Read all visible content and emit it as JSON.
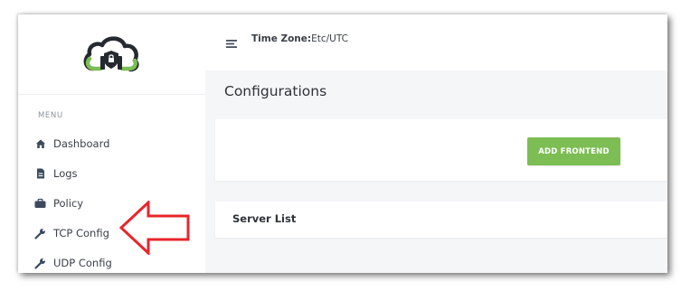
{
  "sidebar": {
    "logo_icon": "cloud-shield-icon",
    "menu_heading": "MENU",
    "items": [
      {
        "label": "Dashboard",
        "icon": "home-icon"
      },
      {
        "label": "Logs",
        "icon": "file-icon"
      },
      {
        "label": "Policy",
        "icon": "briefcase-icon"
      },
      {
        "label": "TCP Config",
        "icon": "wrench-icon"
      },
      {
        "label": "UDP Config",
        "icon": "wrench-icon"
      }
    ]
  },
  "annotation": {
    "type": "arrow",
    "points_to": "TCP Config",
    "color": "#e8262a"
  },
  "header": {
    "menu_icon": "hamburger-icon",
    "timezone_label": "Time Zone:",
    "timezone_value": "Etc/UTC"
  },
  "main": {
    "page_title": "Configurations",
    "add_button_label": "ADD FRONTEND",
    "server_list_title": "Server List"
  },
  "colors": {
    "accent_green": "#7cbd54",
    "page_background": "#f5f6f8",
    "nav_icon": "#3c4a5e",
    "logo_dark": "#262a30"
  }
}
